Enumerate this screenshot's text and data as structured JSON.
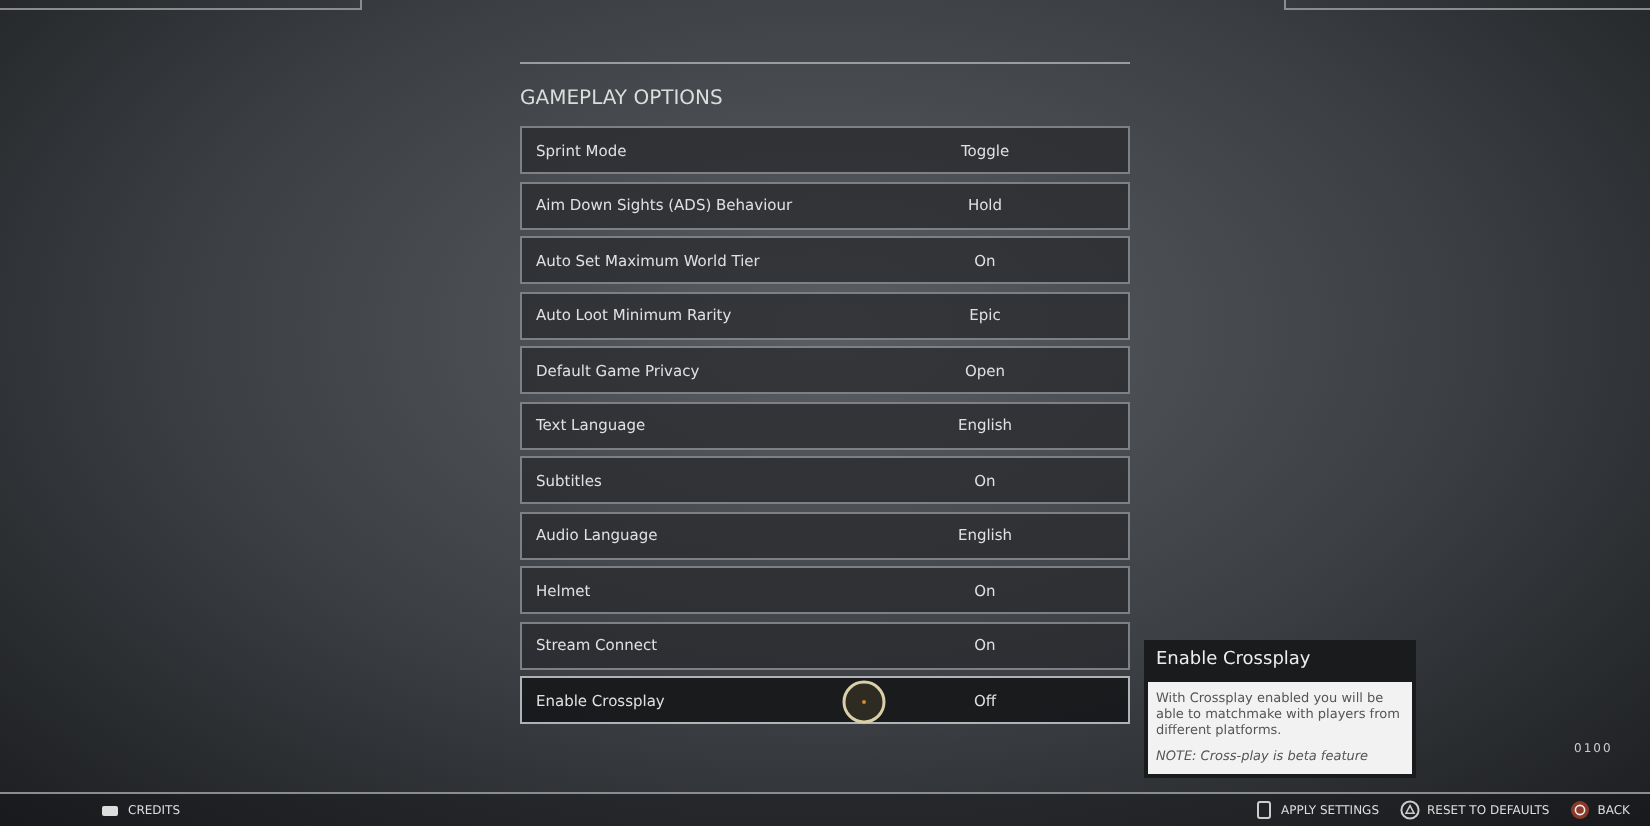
{
  "section_title": "GAMEPLAY OPTIONS",
  "options": [
    {
      "label": "Sprint Mode",
      "value": "Toggle",
      "selected": false
    },
    {
      "label": "Aim Down Sights (ADS) Behaviour",
      "value": "Hold",
      "selected": false
    },
    {
      "label": "Auto Set Maximum World Tier",
      "value": "On",
      "selected": false
    },
    {
      "label": "Auto Loot Minimum Rarity",
      "value": "Epic",
      "selected": false
    },
    {
      "label": "Default Game Privacy",
      "value": "Open",
      "selected": false
    },
    {
      "label": "Text Language",
      "value": "English",
      "selected": false
    },
    {
      "label": "Subtitles",
      "value": "On",
      "selected": false
    },
    {
      "label": "Audio Language",
      "value": "English",
      "selected": false
    },
    {
      "label": "Helmet",
      "value": "On",
      "selected": false
    },
    {
      "label": "Stream Connect",
      "value": "On",
      "selected": false
    },
    {
      "label": "Enable Crossplay",
      "value": "Off",
      "selected": true
    }
  ],
  "tooltip": {
    "title": "Enable Crossplay",
    "body": "With Crossplay enabled you will be able to matchmake with players from different platforms.",
    "note": "NOTE: Cross-play is beta feature"
  },
  "version": "0100",
  "footer": [
    {
      "kind": "touchpad",
      "label": "CREDITS"
    },
    {
      "kind": "options",
      "label": "APPLY SETTINGS"
    },
    {
      "kind": "triangle",
      "label": "RESET TO DEFAULTS"
    },
    {
      "kind": "circle",
      "label": "BACK"
    }
  ]
}
